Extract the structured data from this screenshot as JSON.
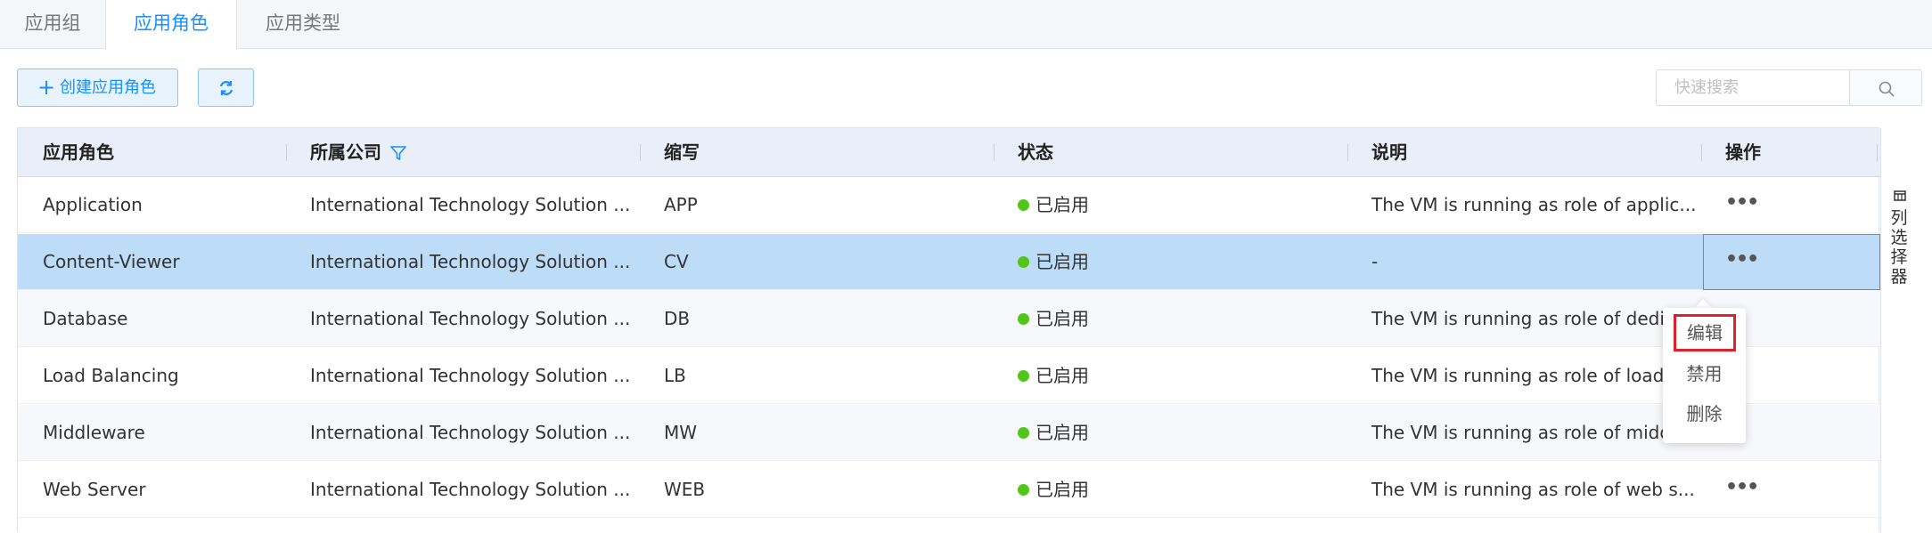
{
  "tabs": [
    {
      "label": "应用组"
    },
    {
      "label": "应用角色"
    },
    {
      "label": "应用类型"
    }
  ],
  "toolbar": {
    "create_label": "创建应用角色",
    "search_placeholder": "快速搜索"
  },
  "table": {
    "columns": [
      "应用角色",
      "所属公司",
      "缩写",
      "状态",
      "说明",
      "操作"
    ],
    "rows": [
      {
        "name": "Application",
        "company": "International Technology Solution ...",
        "abbr": "APP",
        "status": "已启用",
        "desc": "The VM is running as role of applic...",
        "op": "•••"
      },
      {
        "name": "Content-Viewer",
        "company": "International Technology Solution ...",
        "abbr": "CV",
        "status": "已启用",
        "desc": "-",
        "op": "•••"
      },
      {
        "name": "Database",
        "company": "International Technology Solution ...",
        "abbr": "DB",
        "status": "已启用",
        "desc": "The VM is running as role of dedica",
        "op": ""
      },
      {
        "name": "Load Balancing",
        "company": "International Technology Solution ...",
        "abbr": "LB",
        "status": "已启用",
        "desc": "The VM is running as role of load b",
        "op": ""
      },
      {
        "name": "Middleware",
        "company": "International Technology Solution ...",
        "abbr": "MW",
        "status": "已启用",
        "desc": "The VM is running as role of middl...",
        "op": ""
      },
      {
        "name": "Web Server",
        "company": "International Technology Solution ...",
        "abbr": "WEB",
        "status": "已启用",
        "desc": "The VM is running as role of web s...",
        "op": "•••"
      }
    ],
    "status_color": "#52c41a",
    "selected_row_color": "#bcdcf8"
  },
  "column_selector": {
    "label": "列选择器"
  },
  "action_menu": {
    "items": [
      "编辑",
      "禁用",
      "删除"
    ],
    "highlighted": "编辑"
  },
  "colors": {
    "accent": "#1890ff",
    "highlight_box": "#e0202b"
  }
}
